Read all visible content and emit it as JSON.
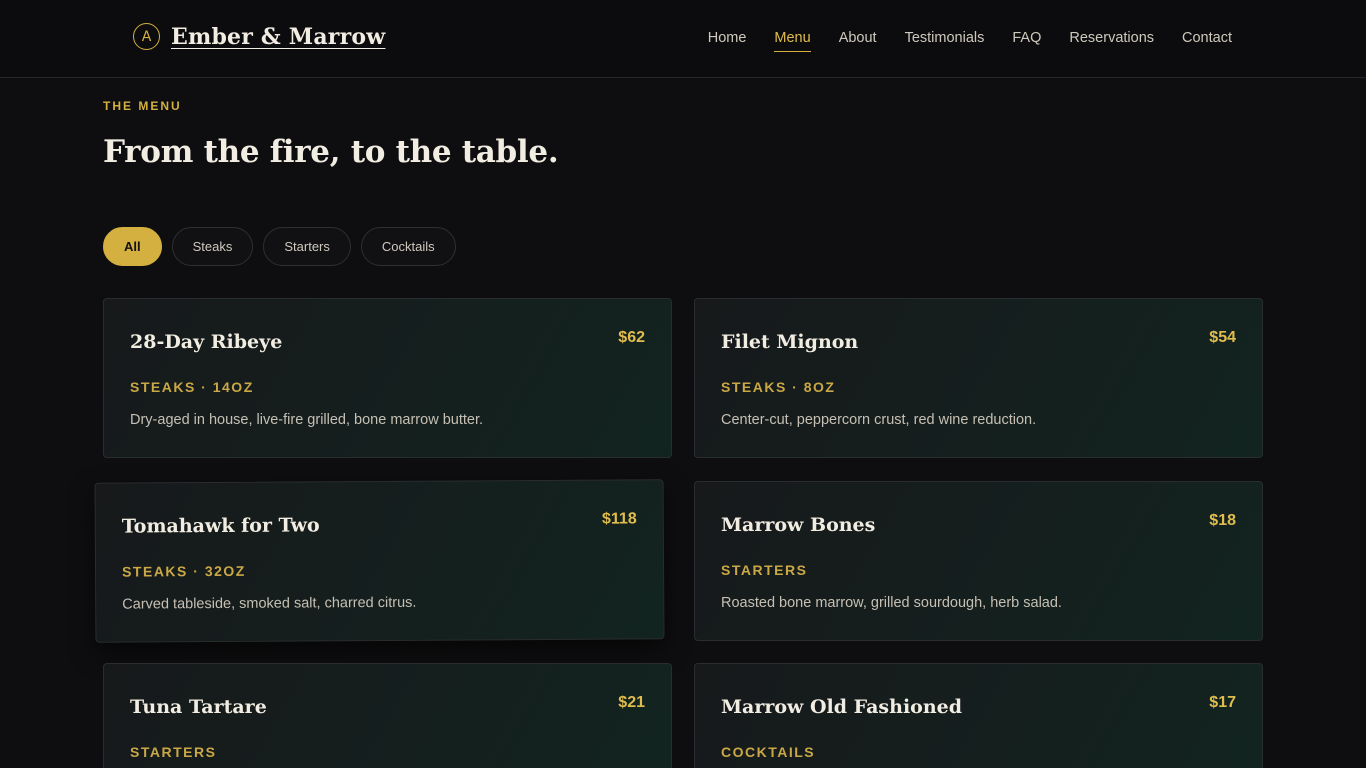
{
  "brand": {
    "mark": "A",
    "name": "Ember & Marrow"
  },
  "nav": [
    {
      "label": "Home",
      "active": false
    },
    {
      "label": "Menu",
      "active": true
    },
    {
      "label": "About",
      "active": false
    },
    {
      "label": "Testimonials",
      "active": false
    },
    {
      "label": "FAQ",
      "active": false
    },
    {
      "label": "Reservations",
      "active": false
    },
    {
      "label": "Contact",
      "active": false
    }
  ],
  "section": {
    "eyebrow": "THE MENU",
    "title": "From the fire, to the table."
  },
  "filters": [
    {
      "label": "All",
      "active": true
    },
    {
      "label": "Steaks",
      "active": false
    },
    {
      "label": "Starters",
      "active": false
    },
    {
      "label": "Cocktails",
      "active": false
    }
  ],
  "items": [
    {
      "name": "28-Day Ribeye",
      "price": "$62",
      "meta": "STEAKS · 14OZ",
      "desc": "Dry-aged in house, live-fire grilled, bone marrow butter."
    },
    {
      "name": "Filet Mignon",
      "price": "$54",
      "meta": "STEAKS · 8OZ",
      "desc": "Center-cut, peppercorn crust, red wine reduction."
    },
    {
      "name": "Tomahawk for Two",
      "price": "$118",
      "meta": "STEAKS · 32OZ",
      "desc": "Carved tableside, smoked salt, charred citrus."
    },
    {
      "name": "Marrow Bones",
      "price": "$18",
      "meta": "STARTERS",
      "desc": "Roasted bone marrow, grilled sourdough, herb salad."
    },
    {
      "name": "Tuna Tartare",
      "price": "$21",
      "meta": "STARTERS",
      "desc": ""
    },
    {
      "name": "Marrow Old Fashioned",
      "price": "$17",
      "meta": "COCKTAILS",
      "desc": ""
    }
  ],
  "colors": {
    "accent": "#d4b040",
    "background": "#0e0e10",
    "card": "#122420"
  }
}
